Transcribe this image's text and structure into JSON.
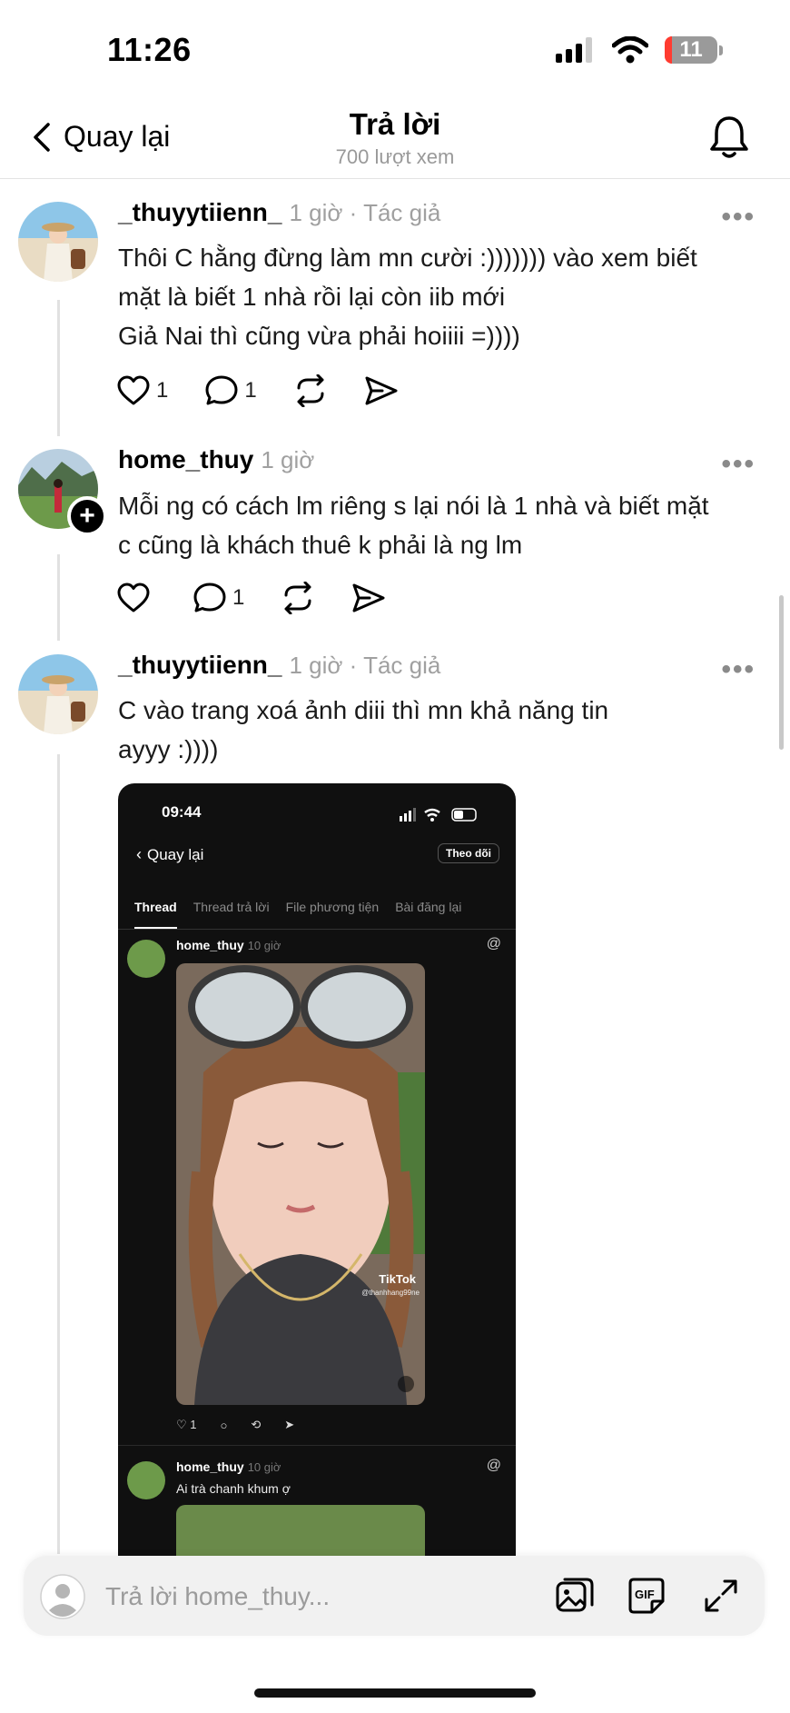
{
  "status_bar": {
    "time": "11:26",
    "battery": "11"
  },
  "header": {
    "back_label": "Quay lại",
    "title": "Trả lời",
    "subtitle": "700 lượt xem"
  },
  "posts": [
    {
      "username": "_thuyytiienn_",
      "meta": "1 giờ · Tác giả",
      "lines": [
        "Thôi C hằng đừng làm mn cười :))))))) vào xem biết",
        "mặt là biết 1 nhà rồi lại còn iib mới",
        "Giả Nai thì cũng vừa phải hoiiii =))))"
      ],
      "likes": "1",
      "replies": "1"
    },
    {
      "username": "home_thuy",
      "meta": "1 giờ",
      "lines": [
        "Mỗi ng có cách lm riêng s lại nói là 1 nhà và biết mặt",
        "c cũng là khách thuê k phải là ng lm"
      ],
      "likes": "",
      "replies": "1"
    },
    {
      "username": "_thuyytiienn_",
      "meta": "1 giờ · Tác giả",
      "lines": [
        "C vào trang xoá ảnh diii thì mn khả năng tin",
        "ayyy :))))"
      ]
    }
  ],
  "screenshot": {
    "time": "09:44",
    "back_label": "Quay lại",
    "follow_label": "Theo dõi",
    "tabs": [
      "Thread",
      "Thread trả lời",
      "File phương tiện",
      "Bài đăng lại"
    ],
    "post1": {
      "username": "home_thuy",
      "meta": "10 giờ",
      "likes": "1",
      "watermark": "TikTok",
      "handle": "@thanhhang99ne"
    },
    "post2": {
      "username": "home_thuy",
      "meta": "10 giờ",
      "text": "Ai trà chanh khum ợ"
    }
  },
  "reply_bar": {
    "placeholder": "Trả lời home_thuy..."
  },
  "icons": [
    "chevron-left-icon",
    "bell-icon",
    "heart-icon",
    "comment-icon",
    "repost-icon",
    "share-icon",
    "more-icon",
    "gallery-icon",
    "gif-icon",
    "expand-icon",
    "signal-icon",
    "wifi-icon"
  ]
}
